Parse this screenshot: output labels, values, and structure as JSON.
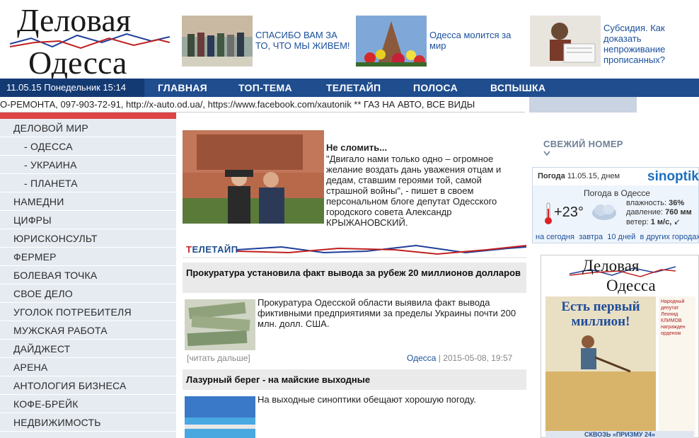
{
  "header": {
    "logo_line1": "Деловая",
    "logo_line2": "Одесса",
    "teasers": [
      {
        "text": "СПАСИБО ВАМ ЗА ТО, ЧТО МЫ ЖИВЕМ!"
      },
      {
        "text": "Одесса молится за мир"
      },
      {
        "text": "Субсидия. Как доказать непроживание прописанных?"
      }
    ]
  },
  "nav": {
    "date": "11.05.15 Понедельник 15:14",
    "items": [
      "ГЛАВНАЯ",
      "ТОП-ТЕМА",
      "ТЕЛЕТАЙП",
      "ПОЛОСА",
      "ВСПЫШКА"
    ]
  },
  "ticker": "О-РЕМОНТА, 097-903-72-91, http://x-auto.od.ua/, https://www.facebook.com/xautonik ** ГАЗ НА АВТО, ВСЕ ВИДЫ",
  "sidebar": {
    "items": [
      {
        "label": "ДЕЛОВОЙ МИР",
        "sub": false
      },
      {
        "label": "- ОДЕССА",
        "sub": true
      },
      {
        "label": "- УКРАИНА",
        "sub": true
      },
      {
        "label": "- ПЛАНЕТА",
        "sub": true
      },
      {
        "label": "НАМЕДНИ",
        "sub": false
      },
      {
        "label": "ЦИФРЫ",
        "sub": false
      },
      {
        "label": "ЮРИСКОНСУЛЬТ",
        "sub": false
      },
      {
        "label": "ФЕРМЕР",
        "sub": false
      },
      {
        "label": "БОЛЕВАЯ ТОЧКА",
        "sub": false
      },
      {
        "label": "СВОЕ ДЕЛО",
        "sub": false
      },
      {
        "label": "УГОЛОК ПОТРЕБИТЕЛЯ",
        "sub": false
      },
      {
        "label": "МУЖСКАЯ РАБОТА",
        "sub": false
      },
      {
        "label": "ДАЙДЖЕСТ",
        "sub": false
      },
      {
        "label": "АРЕНА",
        "sub": false
      },
      {
        "label": "АНТОЛОГИЯ БИЗНЕСА",
        "sub": false
      },
      {
        "label": "КОФЕ-БРЕЙК",
        "sub": false
      },
      {
        "label": "НЕДВИЖИМОСТЬ",
        "sub": false
      }
    ]
  },
  "feature": {
    "title": "Не сломить...",
    "text": "\"Двигало нами только одно – огромное желание воздать дань уважения отцам и дедам, ставшим героями той, самой страшной войны\", - пишет в своем персональном блоге депутат Одесского городского совета Александр КРЫЖАНОВСКИЙ."
  },
  "teletype": {
    "label_first": "Т",
    "label_rest": "ЕЛЕТАЙП"
  },
  "articles": [
    {
      "title": "Прокуратура установила факт вывода за рубеж 20 миллионов долларов",
      "text": "Прокуратура Одесской области выявила факт вывода фиктивными предприятиями за пределы Украины почти 200 млн. долл. США.",
      "more": "[читать дальше]",
      "city": "Одесса",
      "date": " | 2015-05-08, 19:57"
    },
    {
      "title": "Лазурный берег - на майские выходные",
      "text": "На выходные синоптики обещают хорошую погоду."
    }
  ],
  "right": {
    "fresh_issue": "СВЕЖИЙ НОМЕР",
    "weather": {
      "day_label": "Погода",
      "day_value": "11.05.15, днем",
      "brand": "sinoptik",
      "city_label": "Погода в Одессе",
      "temp": "+23°",
      "humidity_label": "влажность:",
      "humidity": "36%",
      "pressure_label": "давление:",
      "pressure": "760 мм",
      "wind_label": "ветер:",
      "wind": "1 м/с,",
      "links": [
        "на сегодня",
        "завтра",
        "10 дней",
        "в других городах"
      ]
    },
    "paper": {
      "name1": "Деловая",
      "name2": "Одесса",
      "headline": "Есть первый миллион!",
      "side_text": "Народный депутат Леонид КЛИМОВ награжден орденом",
      "bottom": "СКВОЗЬ «ПРИЗМУ 24»"
    }
  },
  "colors": {
    "nav": "#1f4d8e",
    "nav_date": "#143a73",
    "accent_red": "#d44",
    "link": "#1a4f9c"
  }
}
